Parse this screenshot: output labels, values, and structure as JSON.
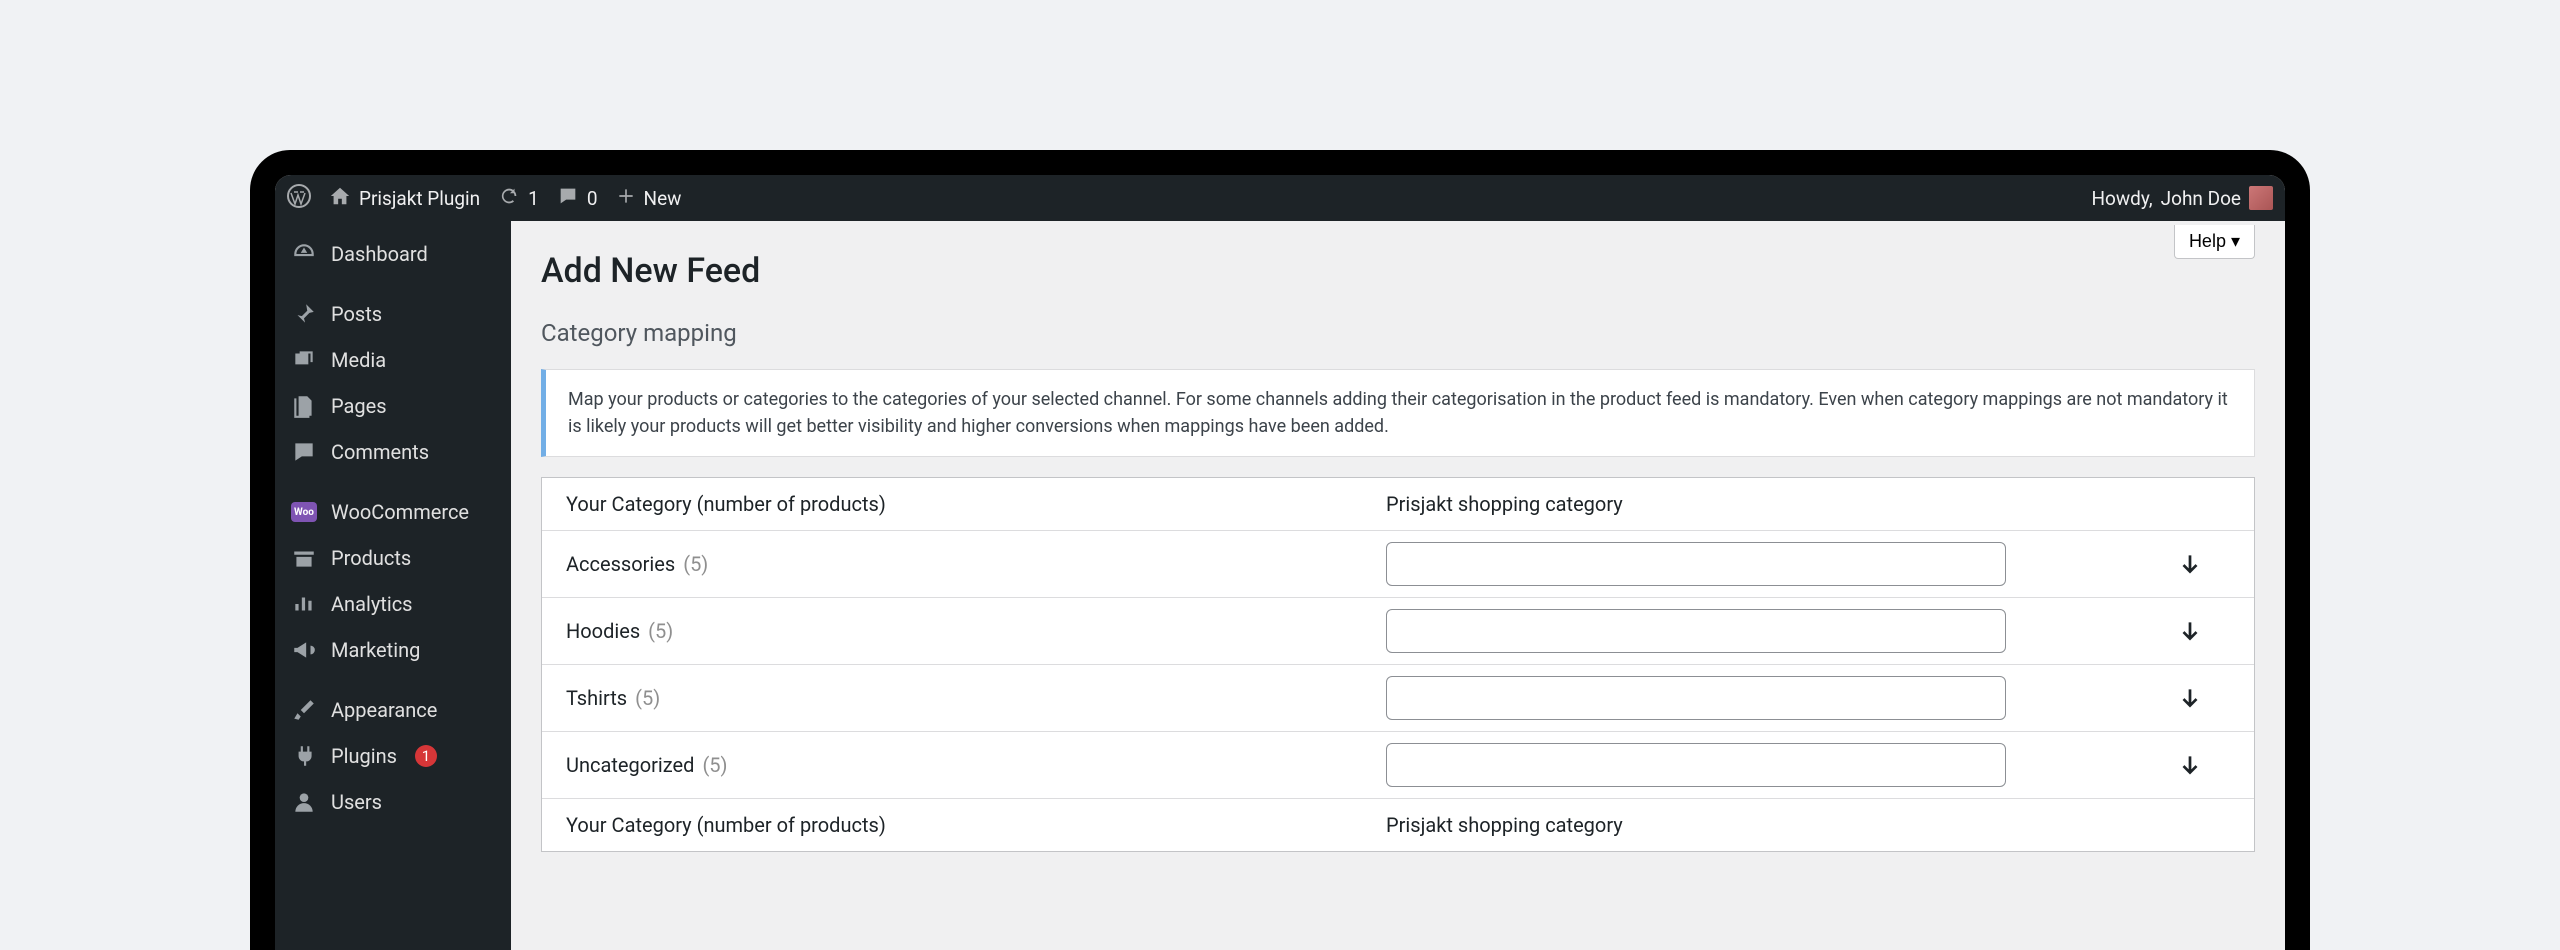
{
  "adminbar": {
    "site_name": "Prisjakt Plugin",
    "updates_count": "1",
    "comments_count": "0",
    "new_label": "New",
    "howdy_prefix": "Howdy, ",
    "user_name": "John Doe"
  },
  "help_label": "Help ▾",
  "sidebar": {
    "items": [
      {
        "id": "dashboard",
        "label": "Dashboard",
        "icon": "dashboard"
      },
      {
        "id": "posts",
        "label": "Posts",
        "icon": "pin",
        "sep": true
      },
      {
        "id": "media",
        "label": "Media",
        "icon": "media"
      },
      {
        "id": "pages",
        "label": "Pages",
        "icon": "pages"
      },
      {
        "id": "comments",
        "label": "Comments",
        "icon": "comment"
      },
      {
        "id": "woocommerce",
        "label": "WooCommerce",
        "icon": "woo",
        "sep": true
      },
      {
        "id": "products",
        "label": "Products",
        "icon": "products"
      },
      {
        "id": "analytics",
        "label": "Analytics",
        "icon": "analytics"
      },
      {
        "id": "marketing",
        "label": "Marketing",
        "icon": "megaphone"
      },
      {
        "id": "appearance",
        "label": "Appearance",
        "icon": "brush",
        "sep": true
      },
      {
        "id": "plugins",
        "label": "Plugins",
        "icon": "plug",
        "badge": "1"
      },
      {
        "id": "users",
        "label": "Users",
        "icon": "user"
      }
    ]
  },
  "page": {
    "title": "Add New Feed",
    "section_title": "Category mapping",
    "notice": "Map your products or categories to the categories of your selected channel. For some channels adding their categorisation in the product feed is mandatory. Even when category mappings are not mandatory it is likely your products will get better visibility and higher conversions when mappings have been added.",
    "table": {
      "header_left": "Your Category (number of products)",
      "header_right": "Prisjakt shopping category",
      "rows": [
        {
          "name": "Accessories",
          "count": "(5)",
          "value": ""
        },
        {
          "name": "Hoodies",
          "count": "(5)",
          "value": ""
        },
        {
          "name": "Tshirts",
          "count": "(5)",
          "value": ""
        },
        {
          "name": "Uncategorized",
          "count": "(5)",
          "value": ""
        }
      ]
    }
  }
}
